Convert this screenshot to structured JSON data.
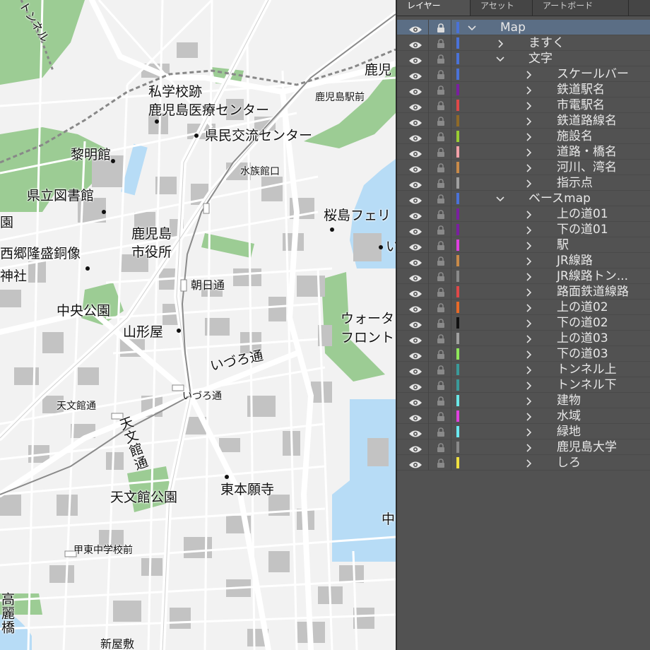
{
  "map": {
    "colors": {
      "ground": "#f2f2f2",
      "water": "#b7dcf6",
      "green": "#9ccc94",
      "road": "#ffffff",
      "building": "#c3c3c3"
    },
    "labels": {
      "tunnel": "トンネル",
      "kagoshima_station": "鹿児",
      "kagoshima_station_front": "鹿児島駅前",
      "shigakkou": "私学校跡",
      "iryou_center": "鹿児島医療センター",
      "kenmin_center": "県民交流センター",
      "reimeikan": "黎明館",
      "kenritsu_library": "県立図書館",
      "suizokukan_guchi": "水族館口",
      "sakurajima_ferry": "桜島フェリ",
      "kagoshima_city_hall_1": "鹿児島",
      "kagoshima_city_hall_2": "市役所",
      "saigo_statue": "西郷隆盛銅像",
      "shrine": "神社",
      "edge_en": "園",
      "asahi_dori": "朝日通",
      "chuo_park": "中央公園",
      "yamakataya": "山形屋",
      "waterfront_1": "ウォータ",
      "waterfront_2": "フロント",
      "izuro_dori_1": "いづろ通",
      "izuro_dori_2": "いづろ通",
      "tenmonkan_dori_stop": "天文館通",
      "tenmonkan_dori": "天文館通",
      "tenmonkan_park": "天文館公園",
      "higashi_honganji": "東本願寺",
      "komyo_junior_high": "甲東中学校前",
      "chu_edge": "中",
      "koraibashi": "高麗橋",
      "shinyashiki": "新屋敷",
      "i_edge": "い"
    }
  },
  "panel": {
    "tabs": [
      "レイヤー",
      "アセット",
      "アートボード"
    ],
    "layers": [
      {
        "name": "Map",
        "indent": 0,
        "expanded": true,
        "color": "#4a72d8",
        "selected": true
      },
      {
        "name": "ますく",
        "indent": 1,
        "expanded": false,
        "color": "#4a72d8"
      },
      {
        "name": "文字",
        "indent": 1,
        "expanded": true,
        "color": "#4a72d8"
      },
      {
        "name": "スケールバー",
        "indent": 2,
        "expanded": false,
        "color": "#4a72d8"
      },
      {
        "name": "鉄道駅名",
        "indent": 2,
        "expanded": false,
        "color": "#7a1fa0"
      },
      {
        "name": "市電駅名",
        "indent": 2,
        "expanded": false,
        "color": "#e04848"
      },
      {
        "name": "鉄道路線名",
        "indent": 2,
        "expanded": false,
        "color": "#8f6a28"
      },
      {
        "name": "施設名",
        "indent": 2,
        "expanded": false,
        "color": "#9acd32"
      },
      {
        "name": "道路・橋名",
        "indent": 2,
        "expanded": false,
        "color": "#f2a0a8"
      },
      {
        "name": "河川、湾名",
        "indent": 2,
        "expanded": false,
        "color": "#c88a48"
      },
      {
        "name": "指示点",
        "indent": 2,
        "expanded": false,
        "color": "#a0a0a0"
      },
      {
        "name": "ベースmap",
        "indent": 1,
        "expanded": true,
        "color": "#4a72d8"
      },
      {
        "name": "上の道01",
        "indent": 2,
        "expanded": false,
        "color": "#7a1fa0"
      },
      {
        "name": "下の道01",
        "indent": 2,
        "expanded": false,
        "color": "#7a1fa0"
      },
      {
        "name": "駅",
        "indent": 2,
        "expanded": false,
        "color": "#e040e0"
      },
      {
        "name": "JR線路",
        "indent": 2,
        "expanded": false,
        "color": "#c88a48"
      },
      {
        "name": "JR線路トン...",
        "indent": 2,
        "expanded": false,
        "color": "#8a8a8a"
      },
      {
        "name": "路面鉄道線路",
        "indent": 2,
        "expanded": false,
        "color": "#e04848"
      },
      {
        "name": "上の道02",
        "indent": 2,
        "expanded": false,
        "color": "#e86a28"
      },
      {
        "name": "下の道02",
        "indent": 2,
        "expanded": false,
        "color": "#111111"
      },
      {
        "name": "上の道03",
        "indent": 2,
        "expanded": false,
        "color": "#a0a0a0"
      },
      {
        "name": "下の道03",
        "indent": 2,
        "expanded": false,
        "color": "#8ee85a"
      },
      {
        "name": "トンネル上",
        "indent": 2,
        "expanded": false,
        "color": "#3a9a9a"
      },
      {
        "name": "トンネル下",
        "indent": 2,
        "expanded": false,
        "color": "#3a9a9a"
      },
      {
        "name": "建物",
        "indent": 2,
        "expanded": false,
        "color": "#6ae8e8"
      },
      {
        "name": "水域",
        "indent": 2,
        "expanded": false,
        "color": "#e040e0"
      },
      {
        "name": "緑地",
        "indent": 2,
        "expanded": false,
        "color": "#6ae8f0"
      },
      {
        "name": "鹿児島大学",
        "indent": 2,
        "expanded": false,
        "color": "#8a8a8a"
      },
      {
        "name": "しろ",
        "indent": 2,
        "expanded": false,
        "color": "#f0e040"
      }
    ]
  }
}
